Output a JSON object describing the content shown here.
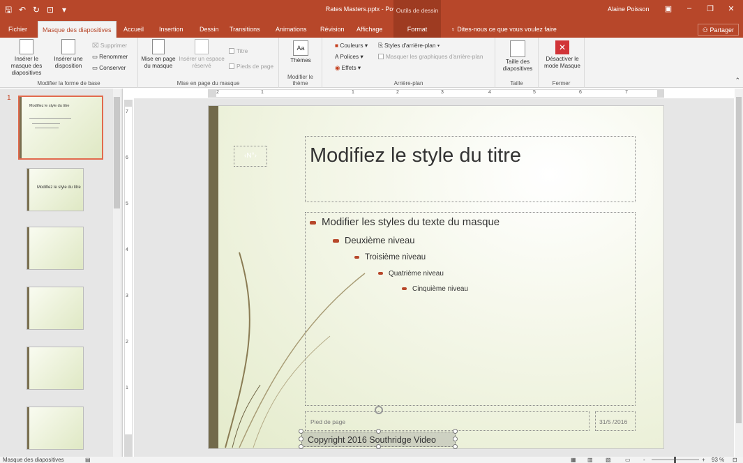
{
  "window": {
    "title": "Rates Masters.pptx - PowerPoint",
    "context_header": "Outils de dessin",
    "user": "Alaine Poisson"
  },
  "qat": {
    "save": "🖫",
    "undo": "↶",
    "redo": "↻",
    "present": "⊡",
    "customize": "▾"
  },
  "tabs": [
    {
      "label": "Fichier"
    },
    {
      "label": "Masque des diapositives"
    },
    {
      "label": "Accueil"
    },
    {
      "label": "Insertion"
    },
    {
      "label": "Dessin"
    },
    {
      "label": "Transitions"
    },
    {
      "label": "Animations"
    },
    {
      "label": "Révision"
    },
    {
      "label": "Affichage"
    },
    {
      "label": "Format"
    }
  ],
  "tell_me": "Dites-nous ce que vous voulez faire",
  "share": "Partager",
  "ribbon": {
    "groups": {
      "edit_master": "Modifier la forme de base",
      "master_layout": "Mise en page du masque",
      "edit_theme": "Modifier le thème",
      "background": "Arrière-plan",
      "size": "Taille",
      "close": "Fermer"
    },
    "insert_master": "Insérer le masque des diapositives",
    "insert_layout": "Insérer une disposition",
    "delete": "Supprimer",
    "rename": "Renommer",
    "preserve": "Conserver",
    "master_layout_btn": "Mise en page du masque",
    "insert_placeholder": "Insérer un espace réservé",
    "title_chk": "Titre",
    "footers_chk": "Pieds de page",
    "themes": "Thèmes",
    "colors": "Couleurs",
    "fonts": "Polices",
    "effects": "Effets",
    "bg_styles": "Styles d'arrière-plan",
    "hide_bg": "Masquer les graphiques d'arrière-plan",
    "slide_size": "Taille des diapositives",
    "close_master": "Désactiver le mode Masque"
  },
  "thumbs": {
    "number": "1",
    "master_title": "Modifiez le style du titre",
    "layout_title": "Modifiez le style du titre"
  },
  "rulers": {
    "h": [
      "2",
      "1",
      "1",
      "2",
      "3",
      "4",
      "5",
      "6",
      "7"
    ],
    "v": [
      "7",
      "6",
      "5",
      "4",
      "3",
      "2",
      "1"
    ]
  },
  "slide": {
    "number_ph": "‹N°›",
    "title": "Modifiez le style du titre",
    "bullets": [
      "Modifier les styles du texte du masque",
      "Deuxième niveau",
      "Troisième niveau",
      "Quatrième niveau",
      "Cinquième niveau"
    ],
    "footer": "Pied de page",
    "date": "31/5 /2016",
    "copyright": "Copyright 2016 Southridge Video"
  },
  "status": {
    "mode": "Masque des diapositives",
    "zoom": "93 %",
    "minus": "-",
    "plus": "+"
  }
}
